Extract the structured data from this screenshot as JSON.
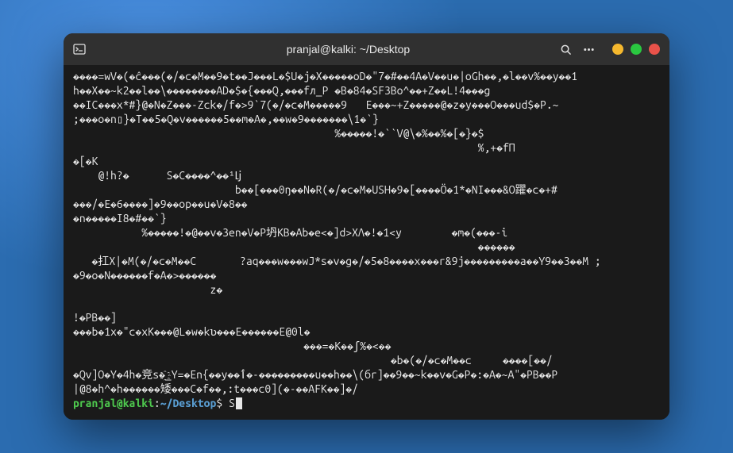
{
  "titlebar": {
    "title": "pranjal@kalki: ~/Desktop"
  },
  "prompt": {
    "user_host": "pranjal@kalki",
    "sep": ":",
    "path": "~/Desktop",
    "symbol": "$ ",
    "input": "S"
  },
  "lines": [
    "����=wV�(�ĉ���(�/�c�M��9�t��J���L�$U�j�X�����oD�\"7�#��4A�V��u�|oGh��,�l��v%��y��1",
    "h��X��~k2��l��\\��������AD�$�{���Q,���fл_P �B�84�SF3Bo^��+Z��L!4���g",
    "��IC���x*#}@�N�Z���-Zck�/f�>9`7(�/�c�M�����9   E���~+Z�����@�z�y���O���ud$�P.~",
    ";���o�n▯}�T��5�Q�v������5��m�A�,��w�9�������\\1�`}",
    "                                          %�����!�``V@\\�%��%�[�}�$",
    "                                                                 %,+�fП",
    "�[�K",
    "    @!h?�      S�C����^��¹ǈ",
    "                          b��[���0ŋ��N�R(�/�c�M�USH�9�[����Ӧ�1*�NI���&O躍�c�+#",
    "���/�E�6����]�9��op��u�V�8��",
    "�n�����I8�#��`}",
    "           %�����!�@��v�3en�V�P坍KB�Ab�e<�]d>XɅ�!�1<y        �m�(���-i",
    "                                                                 ������",
    "   �扛X|�M(�/�c�M��C       ?aq���w���wJ*s�v�g�/�5�8����x���r&9j���������a��Y9��3��M ;",
    "�9�o�N������f�A�>������",
    "                      z�",
    "",
    "!�PB��]",
    "���b�1x�\"c�xK���@L�w�kʋ���E������E@0l�",
    "                                     ���=�K��ʃ%�<��",
    "                                                   �b�(�/�c�M��c     ����[��/",
    "�Qv]O�Y�4h�竞s�҈_Y=�En{��y��ٲ�-���������u��h��\\(бr]��9��~k��v�G�P�:�A�~A\"�PB��P",
    "|@8�h^�h������矮���C�f��,:t���c0](�-��AFK��]�/"
  ]
}
